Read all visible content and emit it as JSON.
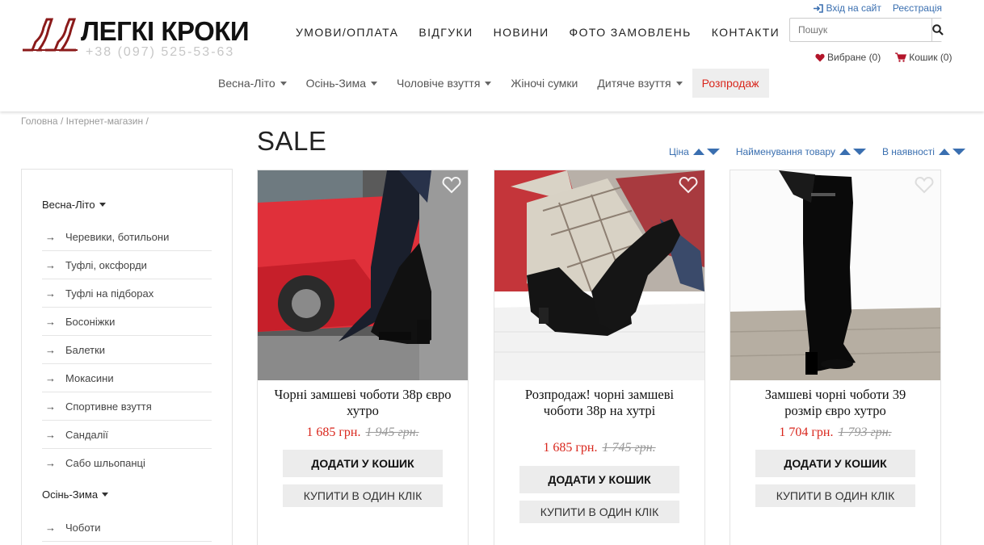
{
  "logo": {
    "title": "ЛЕГКІ КРОКИ",
    "phone": "+38 (097) 525-53-63",
    "brand_color": "#8b1a1a"
  },
  "top_nav": [
    "УМОВИ/ОПЛАТА",
    "ВІДГУКИ",
    "НОВИНИ",
    "ФОТО ЗАМОВЛЕНЬ",
    "КОНТАКТИ"
  ],
  "account": {
    "login": "Вхід на сайт",
    "register": "Реєстрація"
  },
  "search": {
    "placeholder": "Пошук",
    "icon": "search-icon"
  },
  "user_links": {
    "favorites": "Вибране (0)",
    "cart": "Кошик (0)"
  },
  "categories": [
    {
      "label": "Весна-Літо"
    },
    {
      "label": "Осінь-Зима"
    },
    {
      "label": "Чоловіче взуття"
    },
    {
      "label": "Жіночі сумки"
    },
    {
      "label": "Дитяче взуття"
    },
    {
      "label": "Розпродаж"
    }
  ],
  "breadcrumb": [
    "Головна",
    "Інтернет-магазин"
  ],
  "breadcrumb_sep": "/",
  "sidebar": {
    "group1": "Весна-Літо",
    "items1": [
      "Черевики, ботильони",
      "Туфлі, оксфорди",
      "Туфлі на підборах",
      "Босоніжки",
      "Балетки",
      "Мокасини",
      "Спортивне взуття",
      "Сандалії",
      "Сабо шльопанці"
    ],
    "group2": "Осінь-Зима",
    "items2": [
      "Чоботи"
    ],
    "arrow": "→"
  },
  "page_title": "SALE",
  "sort": [
    "Ціна",
    "Найменування товару",
    "В наявності"
  ],
  "products": [
    {
      "name": "Чорні замшеві чоботи 38р євро хутро",
      "price": "1 685 грн.",
      "old_price": "1 945 грн.",
      "cart": "ДОДАТИ У КОШИК",
      "oneclick": "КУПИТИ В ОДИН КЛІК"
    },
    {
      "name": "Розпродаж! чорні замшеві чоботи 38р на хутрі",
      "price": "1 685 грн.",
      "old_price": "1 745 грн.",
      "cart": "ДОДАТИ У КОШИК",
      "oneclick": "КУПИТИ В ОДИН КЛІК"
    },
    {
      "name": "Замшеві чорні чоботи 39 розмір євро хутро",
      "price": "1 704 грн.",
      "old_price": "1 793 грн.",
      "cart": "ДОДАТИ У КОШИК",
      "oneclick": "КУПИТИ В ОДИН КЛІК"
    }
  ],
  "colors": {
    "link": "#3a6fb0",
    "sale": "#d9261c",
    "button_bg": "#ececec"
  }
}
